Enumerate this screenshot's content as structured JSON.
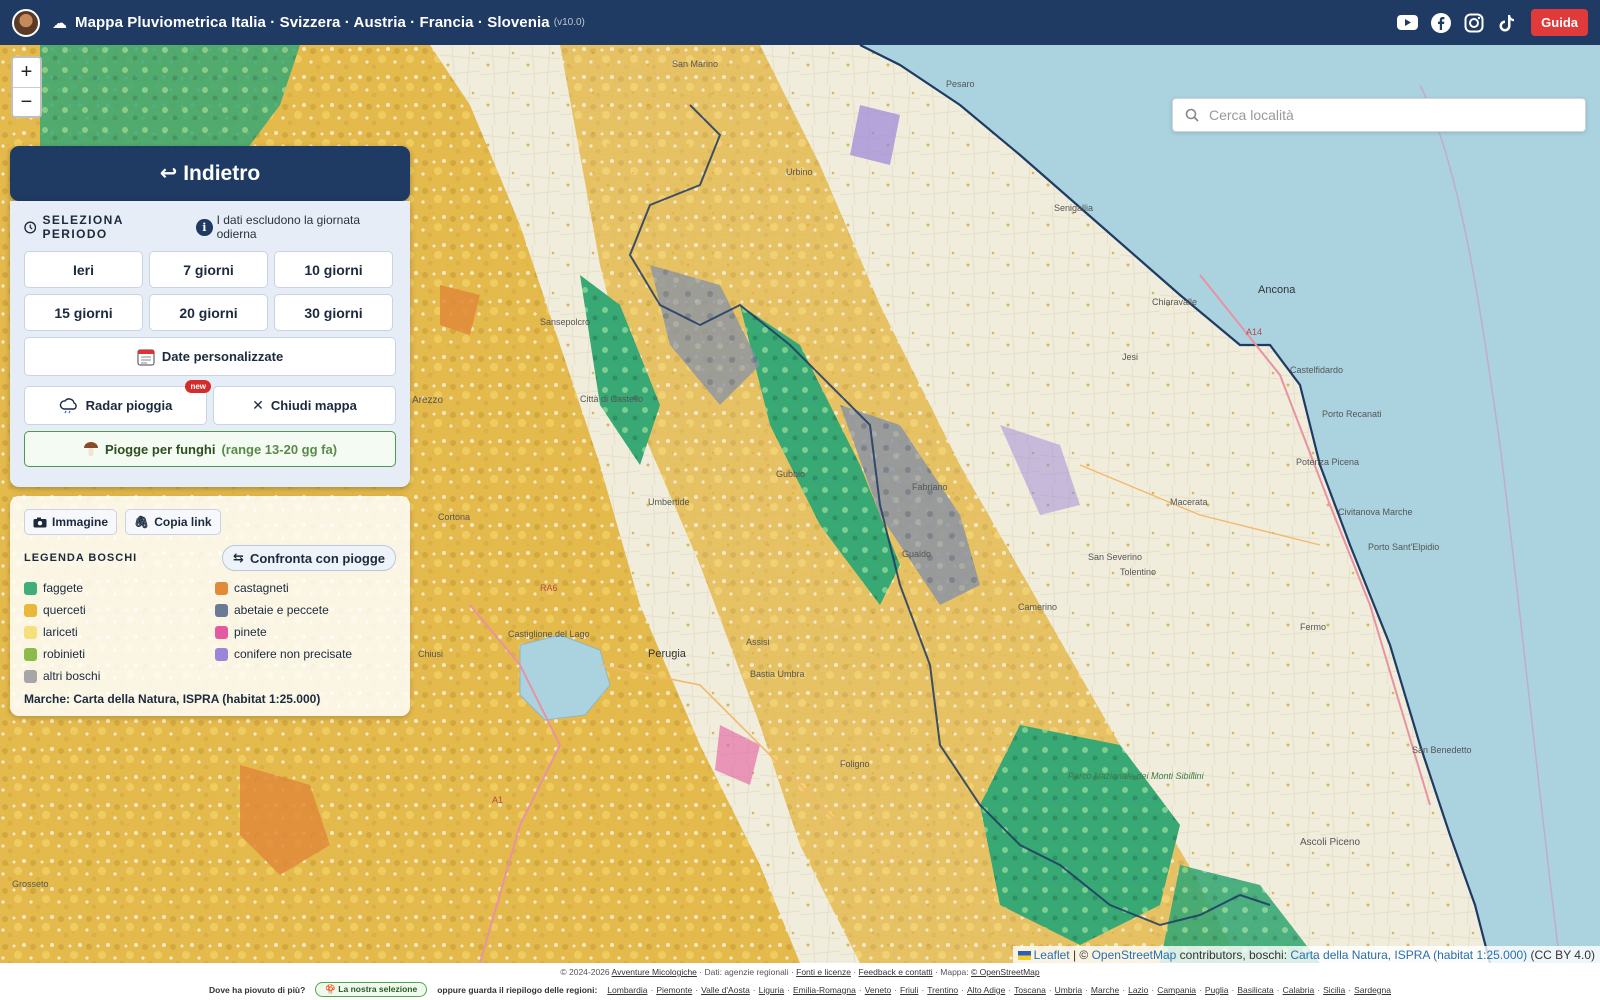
{
  "header": {
    "title": "Mappa Pluviometrica Italia · Svizzera · Austria · Francia · Slovenia",
    "version": "(v10.0)",
    "guide_label": "Guida",
    "social": [
      "youtube-icon",
      "facebook-icon",
      "instagram-icon",
      "tiktok-icon"
    ]
  },
  "map": {
    "zoom_in": "+",
    "zoom_out": "−",
    "search_placeholder": "Cerca località",
    "places": [
      {
        "name": "San Marino"
      },
      {
        "name": "Pesaro"
      },
      {
        "name": "Ancona"
      },
      {
        "name": "Arezzo"
      },
      {
        "name": "Perugia"
      },
      {
        "name": "Foligno"
      },
      {
        "name": "Gubbio"
      },
      {
        "name": "Fabriano"
      },
      {
        "name": "Macerata"
      },
      {
        "name": "Ascoli Piceno"
      },
      {
        "name": "Grosseto"
      },
      {
        "name": "Chiaravalle"
      },
      {
        "name": "Senigallia"
      },
      {
        "name": "Jesi"
      },
      {
        "name": "Castelfidardo"
      },
      {
        "name": "Porto Recanati"
      },
      {
        "name": "Civitanova Marche"
      },
      {
        "name": "Fermo"
      },
      {
        "name": "Tolentino"
      },
      {
        "name": "Camerino"
      },
      {
        "name": "Urbino"
      },
      {
        "name": "Cortona"
      },
      {
        "name": "Sansepolcro"
      },
      {
        "name": "Città di Castello"
      },
      {
        "name": "Umbertide"
      },
      {
        "name": "Assisi"
      },
      {
        "name": "Bastia Umbra"
      },
      {
        "name": "Chiusi"
      },
      {
        "name": "Castiglione del Lago"
      },
      {
        "name": "Gualdo"
      },
      {
        "name": "San Severino"
      },
      {
        "name": "Potenza Picena"
      },
      {
        "name": "Porto Sant'Elpidio"
      },
      {
        "name": "San Benedetto"
      },
      {
        "name": "Parco Nazionale dei Monti Sibillini"
      }
    ],
    "road_labels": [
      "A14",
      "RA6",
      "A1"
    ]
  },
  "panel": {
    "back_label": "↩ Indietro",
    "period_label": "SELEZIONA PERIODO",
    "info_text": "I dati escludono la giornata odierna",
    "periods": [
      "Ieri",
      "7 giorni",
      "10 giorni",
      "15 giorni",
      "20 giorni",
      "30 giorni"
    ],
    "custom_dates": "Date personalizzate",
    "radar": "Radar pioggia",
    "new_badge": "new",
    "close_map": "Chiudi mappa",
    "mushroom_label": "Piogge per funghi",
    "mushroom_range": "(range 13-20 gg fa)"
  },
  "legend": {
    "image_btn": "Immagine",
    "copy_btn": "Copia link",
    "title": "LEGENDA BOSCHI",
    "compare_btn": "Confronta con piogge",
    "items": [
      {
        "label": "faggete",
        "color": "#3fae7a"
      },
      {
        "label": "castagneti",
        "color": "#e08a3a"
      },
      {
        "label": "querceti",
        "color": "#e9b83a"
      },
      {
        "label": "abetaie e peccete",
        "color": "#6a7b95"
      },
      {
        "label": "lariceti",
        "color": "#f6e07c"
      },
      {
        "label": "pinete",
        "color": "#e35aa0"
      },
      {
        "label": "robinieti",
        "color": "#8dbb4a"
      },
      {
        "label": "conifere non precisate",
        "color": "#9b85d8"
      },
      {
        "label": "altri boschi",
        "color": "#a6a6a6"
      }
    ],
    "source": "Marche: Carta della Natura, ISPRA (habitat 1:25.000)"
  },
  "attribution": {
    "leaflet": "Leaflet",
    "sep": " | © ",
    "osm": "OpenStreetMap",
    "mid": " contributors, boschi: ",
    "ispra": "Carta della Natura, ISPRA (habitat 1:25.000)",
    "license": " (CC BY 4.0)"
  },
  "footer": {
    "copyright": "© 2024-2026",
    "brand": "Avventure Micologiche",
    "data_note": " · Dati: agenzie regionali · ",
    "sources": "Fonti e licenze",
    "dot": " · ",
    "feedback": "Feedback e contatti",
    "map_note": " · Mappa: ",
    "osm": "© OpenStreetMap",
    "question": "Dove ha piovuto di più?",
    "selection": "La nostra selezione",
    "or_regions": "oppure guarda il riepilogo delle regioni:",
    "regions": [
      "Lombardia",
      "Piemonte",
      "Valle d'Aosta",
      "Liguria",
      "Emilia-Romagna",
      "Veneto",
      "Friuli",
      "Trentino",
      "Alto Adige",
      "Toscana",
      "Umbria",
      "Marche",
      "Lazio",
      "Campania",
      "Puglia",
      "Basilicata",
      "Calabria",
      "Sicilia",
      "Sardegna"
    ]
  }
}
